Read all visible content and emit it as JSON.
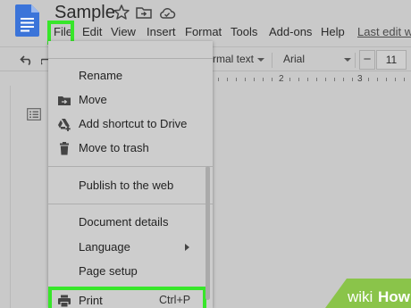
{
  "app": {
    "title": "Sample",
    "last_edit": "Last edit w"
  },
  "menubar": [
    "File",
    "Edit",
    "View",
    "Insert",
    "Format",
    "Tools",
    "Add-ons",
    "Help"
  ],
  "toolbar": {
    "style": "rmal text",
    "font": "Arial",
    "minus": "−",
    "font_size": "11"
  },
  "ruler": {
    "labels": [
      "2",
      "3"
    ]
  },
  "file_menu": {
    "items": [
      {
        "label": "Rename",
        "icon": ""
      },
      {
        "label": "Move",
        "icon": "folder-move-icon"
      },
      {
        "label": "Add shortcut to Drive",
        "icon": "drive-add-shortcut-icon"
      },
      {
        "label": "Move to trash",
        "icon": "trash-icon"
      },
      {
        "label": "Publish to the web",
        "icon": ""
      },
      {
        "label": "Document details",
        "icon": ""
      },
      {
        "label": "Language",
        "icon": "",
        "submenu": true
      },
      {
        "label": "Page setup",
        "icon": ""
      },
      {
        "label": "Print",
        "icon": "printer-icon",
        "shortcut": "Ctrl+P"
      }
    ]
  },
  "highlight_color": "#37e62a",
  "watermark": {
    "prefix": "wiki",
    "suffix": "How"
  }
}
